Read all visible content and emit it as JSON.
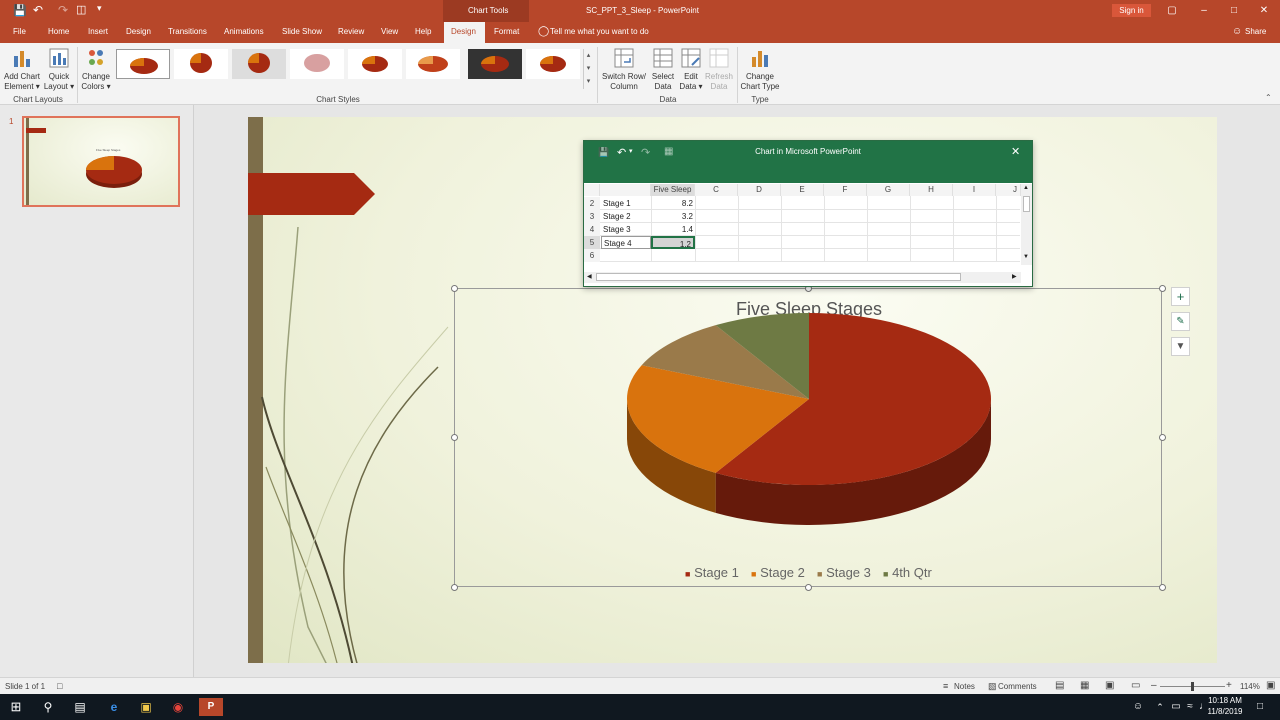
{
  "title_bar": {
    "context_tab": "Chart Tools",
    "document_title": "SC_PPT_3_Sleep  -  PowerPoint",
    "sign_in": "Sign in"
  },
  "menu": {
    "tabs": [
      "File",
      "Home",
      "Insert",
      "Design",
      "Transitions",
      "Animations",
      "Slide Show",
      "Review",
      "View",
      "Help",
      "Design",
      "Format"
    ],
    "active_tab": "Design",
    "tell_me": "Tell me what you want to do",
    "share": "Share"
  },
  "ribbon": {
    "add_chart_element": [
      "Add Chart",
      "Element"
    ],
    "quick_layout": [
      "Quick",
      "Layout"
    ],
    "change_colors": [
      "Change",
      "Colors"
    ],
    "switch_row_column": [
      "Switch Row/",
      "Column"
    ],
    "select_data": [
      "Select",
      "Data"
    ],
    "edit_data": [
      "Edit",
      "Data"
    ],
    "refresh_data": [
      "Refresh",
      "Data"
    ],
    "change_chart_type": [
      "Change",
      "Chart Type"
    ],
    "groups": {
      "chart_layouts": "Chart Layouts",
      "chart_styles": "Chart Styles",
      "data": "Data",
      "type": "Type"
    }
  },
  "slide_pane": {
    "slide_number": "1",
    "thumb_title": "Five Sleep Stages"
  },
  "spreadsheet": {
    "title": "Chart in Microsoft PowerPoint",
    "columns": [
      "C",
      "D",
      "E",
      "F",
      "G",
      "H",
      "I",
      "J"
    ],
    "header_b": "Five Sleep",
    "rows": [
      {
        "num": "2",
        "label": "Stage 1",
        "value": "8.2"
      },
      {
        "num": "3",
        "label": "Stage 2",
        "value": "3.2"
      },
      {
        "num": "4",
        "label": "Stage 3",
        "value": "1.4"
      },
      {
        "num": "5",
        "label": "Stage 4",
        "value": "1.2"
      },
      {
        "num": "6",
        "label": "",
        "value": ""
      }
    ]
  },
  "chart_data": {
    "type": "pie",
    "title": "Five Sleep Stages",
    "categories": [
      "Stage 1",
      "Stage 2",
      "Stage 3",
      "4th Qtr"
    ],
    "values": [
      8.2,
      3.2,
      1.4,
      1.2
    ],
    "colors": [
      "#a52a12",
      "#d9730d",
      "#9a7a4a",
      "#6e7a44"
    ],
    "legend_position": "bottom",
    "three_d": true
  },
  "status": {
    "slide_info": "Slide 1 of 1",
    "notes": "Notes",
    "comments": "Comments",
    "zoom": "114%"
  },
  "taskbar": {
    "time": "10:18 AM",
    "date": "11/8/2019"
  }
}
